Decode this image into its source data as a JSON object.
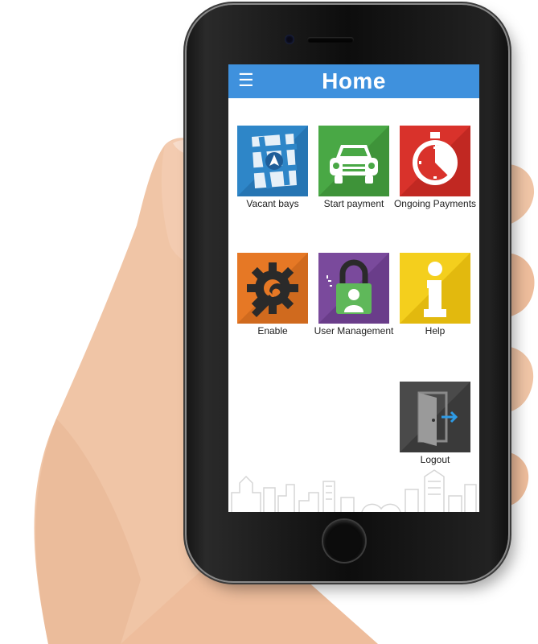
{
  "app_bar": {
    "title": "Home",
    "menu_icon": "hamburger-menu-icon"
  },
  "tiles": [
    {
      "label": "Vacant bays",
      "icon": "map-navigation-icon",
      "color": "#2e86c8"
    },
    {
      "label": "Start payment",
      "icon": "car-icon",
      "color": "#49a845"
    },
    {
      "label": "Ongoing Payments",
      "icon": "stopwatch-icon",
      "color": "#d9322b"
    },
    {
      "label": "Enable",
      "icon": "gear-wrench-icon",
      "color": "#e67825"
    },
    {
      "label": "User Management",
      "icon": "user-lock-icon",
      "color": "#7a4a9c"
    },
    {
      "label": "Help",
      "icon": "info-icon",
      "color": "#f4cf1d"
    },
    {
      "label": "Logout",
      "icon": "logout-door-icon",
      "color": "#4a4a4a"
    }
  ],
  "colors": {
    "app_bar": "#3f91dd",
    "screen_bg": "#ffffff"
  }
}
